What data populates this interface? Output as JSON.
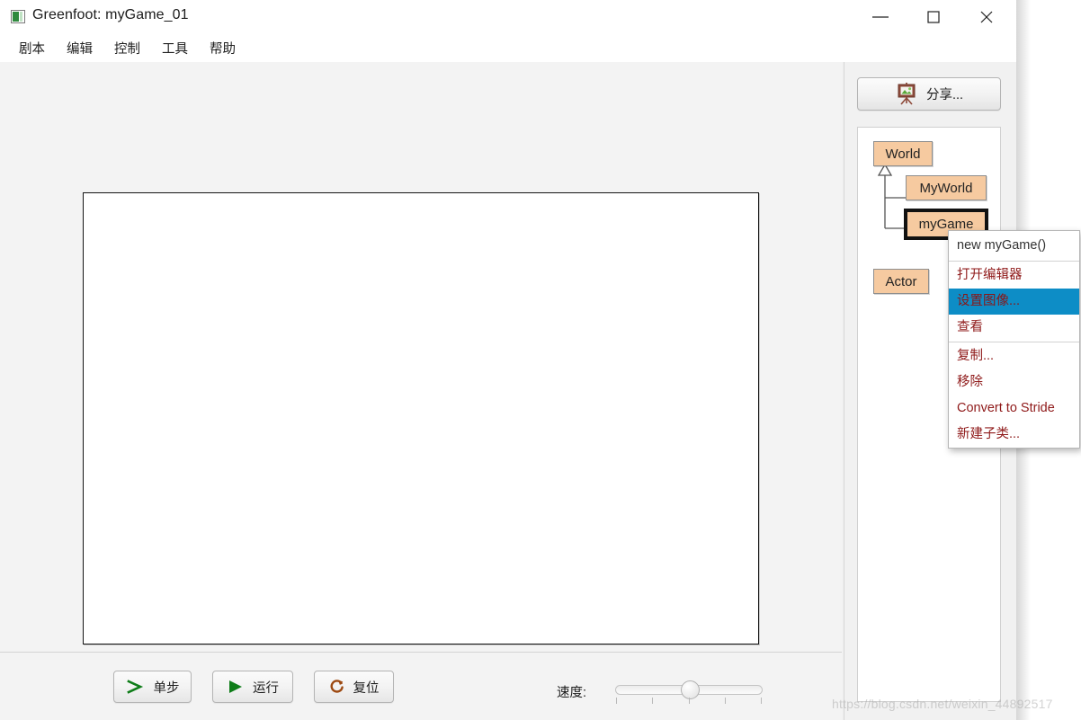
{
  "window": {
    "title": "Greenfoot: myGame_01",
    "app_icon": "greenfoot-app-icon",
    "controls": {
      "minimize": "minimize-icon",
      "maximize": "maximize-icon",
      "close": "close-icon"
    }
  },
  "menubar": {
    "items": [
      {
        "label": "剧本"
      },
      {
        "label": "编辑"
      },
      {
        "label": "控制"
      },
      {
        "label": "工具"
      },
      {
        "label": "帮助"
      }
    ]
  },
  "controls": {
    "step": {
      "label": "单步",
      "icon": "chevron-right-icon",
      "icon_color": "#0f7d19"
    },
    "run": {
      "label": "运行",
      "icon": "play-triangle-icon",
      "icon_color": "#0f7d19"
    },
    "reset": {
      "label": "复位",
      "icon": "reset-circular-arrow-icon",
      "icon_color": "#9d4a12"
    },
    "speed_label": "速度:",
    "speed_value": 55
  },
  "sidebar": {
    "share_button": {
      "label": "分享...",
      "icon": "easel-picture-icon"
    },
    "classes": [
      {
        "name": "World",
        "id": "class-world",
        "selected": false
      },
      {
        "name": "MyWorld",
        "id": "class-myworld",
        "selected": false
      },
      {
        "name": "myGame",
        "id": "class-mygame",
        "selected": true
      },
      {
        "name": "Actor",
        "id": "class-actor",
        "selected": false
      }
    ]
  },
  "context_menu": {
    "items": [
      {
        "label": "new myGame()",
        "style": "plain"
      },
      {
        "separator": true
      },
      {
        "label": "打开编辑器",
        "style": "normal"
      },
      {
        "label": "设置图像...",
        "style": "highlighted"
      },
      {
        "label": "查看",
        "style": "normal"
      },
      {
        "separator": true
      },
      {
        "label": "复制...",
        "style": "normal"
      },
      {
        "label": "移除",
        "style": "normal"
      },
      {
        "label": "Convert to Stride",
        "style": "normal"
      },
      {
        "label": "新建子类...",
        "style": "normal"
      }
    ]
  },
  "watermark": {
    "text": "https://blog.csdn.net/weixin_44892517"
  },
  "colors": {
    "class_box_fill": "#f6caa0",
    "menu_text": "#8f1a1a",
    "highlight": "#0d8dc6",
    "window_bg": "#f1f1f1",
    "world_bg": "#ffffff"
  }
}
